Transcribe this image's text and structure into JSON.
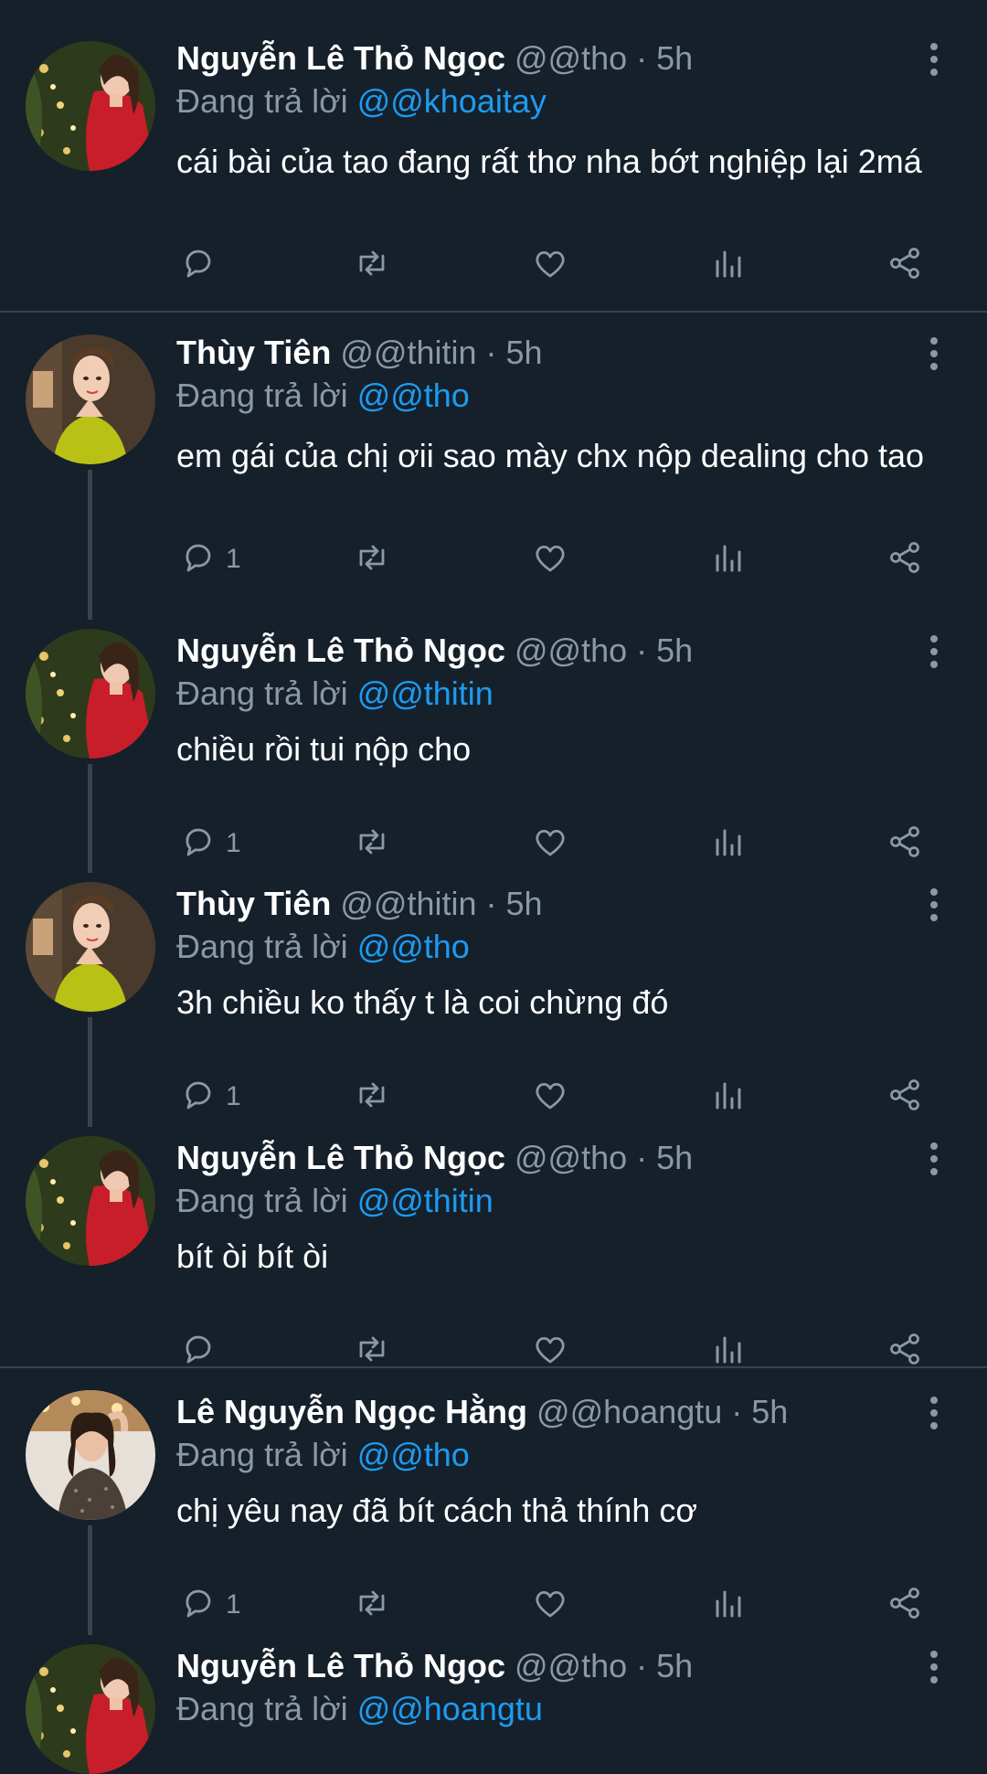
{
  "tweets": [
    {
      "name": "Nguyễn Lê Thỏ Ngọc",
      "handle": "@@tho",
      "sep": " · ",
      "time": "5h",
      "replying_prefix": "Đang trả lời ",
      "replying_to": "@@khoaitay",
      "text": "cái bài của tao đang rất thơ nha bớt nghiệp lại 2má",
      "reply_count": "",
      "avatar": "red-dress-woman-christmas-tree"
    },
    {
      "name": "Thùy Tiên",
      "handle": "@@thitin",
      "sep": " · ",
      "time": "5h",
      "replying_prefix": "Đang trả lời ",
      "replying_to": "@@tho",
      "text": "em gái của chị ơii sao mày chx nộp dealing cho tao",
      "reply_count": "1",
      "avatar": "yellow-halter-woman"
    },
    {
      "name": "Nguyễn Lê Thỏ Ngọc",
      "handle": "@@tho",
      "sep": " · ",
      "time": "5h",
      "replying_prefix": "Đang trả lời ",
      "replying_to": "@@thitin",
      "text": "chiều rồi tui nộp cho",
      "reply_count": "1",
      "avatar": "red-dress-woman-christmas-tree"
    },
    {
      "name": "Thùy Tiên",
      "handle": "@@thitin",
      "sep": " · ",
      "time": "5h",
      "replying_prefix": "Đang trả lời ",
      "replying_to": "@@tho",
      "text": "3h chiều ko thấy t  là coi chừng đó",
      "reply_count": "1",
      "avatar": "yellow-halter-woman"
    },
    {
      "name": "Nguyễn Lê Thỏ Ngọc",
      "handle": "@@tho",
      "sep": " · ",
      "time": "5h",
      "replying_prefix": "Đang trả lời ",
      "replying_to": "@@thitin",
      "text": "bít òi bít òi",
      "reply_count": "",
      "avatar": "red-dress-woman-christmas-tree"
    },
    {
      "name": "Lê Nguyễn Ngọc Hằng",
      "handle": "@@hoangtu",
      "sep": " · ",
      "time": "5h",
      "replying_prefix": "Đang trả lời ",
      "replying_to": "@@tho",
      "text": "chị yêu nay đã bít cách thả thính cơ",
      "reply_count": "1",
      "avatar": "sequin-dress-woman"
    },
    {
      "name": "Nguyễn Lê Thỏ Ngọc",
      "handle": "@@tho",
      "sep": " · ",
      "time": "5h",
      "replying_prefix": "Đang trả lời ",
      "replying_to": "@@hoangtu",
      "text": "",
      "reply_count": "",
      "avatar": "red-dress-woman-christmas-tree"
    }
  ],
  "action_icons": [
    "reply-icon",
    "retweet-icon",
    "like-icon",
    "analytics-icon",
    "share-icon"
  ],
  "colors": {
    "background": "#15202b",
    "text": "#ffffff",
    "secondary": "#8b98a5",
    "link": "#1d9bf0",
    "divider": "#38444d"
  }
}
